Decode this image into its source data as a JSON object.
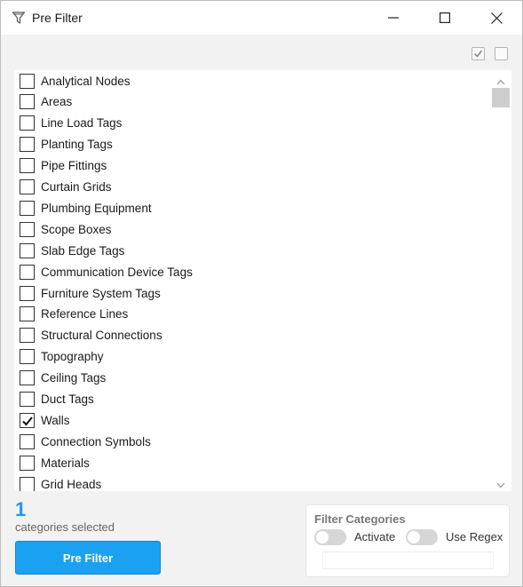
{
  "window": {
    "title": "Pre Filter",
    "icons": {
      "app": "funnel-icon",
      "minimize": "minimize-icon",
      "maximize": "maximize-icon",
      "close": "close-icon"
    }
  },
  "toolbar": {
    "check_all_icon": "check-all-icon",
    "uncheck_all_icon": "uncheck-all-icon"
  },
  "categories": [
    {
      "label": "Analytical Nodes",
      "checked": false
    },
    {
      "label": "Areas",
      "checked": false
    },
    {
      "label": "Line Load Tags",
      "checked": false
    },
    {
      "label": "Planting Tags",
      "checked": false
    },
    {
      "label": "Pipe Fittings",
      "checked": false
    },
    {
      "label": "Curtain Grids",
      "checked": false
    },
    {
      "label": "Plumbing Equipment",
      "checked": false
    },
    {
      "label": "Scope Boxes",
      "checked": false
    },
    {
      "label": "Slab Edge Tags",
      "checked": false
    },
    {
      "label": "Communication Device Tags",
      "checked": false
    },
    {
      "label": "Furniture System Tags",
      "checked": false
    },
    {
      "label": "Reference Lines",
      "checked": false
    },
    {
      "label": "Structural Connections",
      "checked": false
    },
    {
      "label": "Topography",
      "checked": false
    },
    {
      "label": "Ceiling Tags",
      "checked": false
    },
    {
      "label": "Duct Tags",
      "checked": false
    },
    {
      "label": "Walls",
      "checked": true
    },
    {
      "label": "Connection Symbols",
      "checked": false
    },
    {
      "label": "Materials",
      "checked": false
    },
    {
      "label": "Grid Heads",
      "checked": false
    }
  ],
  "summary": {
    "count": "1",
    "count_label": "categories selected",
    "button_label": "Pre Filter"
  },
  "filter_categories": {
    "title": "Filter Categories",
    "activate_label": "Activate",
    "activate_on": false,
    "regex_label": "Use Regex",
    "regex_on": false,
    "input_value": ""
  },
  "colors": {
    "accent": "#1ba1f2",
    "count": "#2196f3"
  }
}
